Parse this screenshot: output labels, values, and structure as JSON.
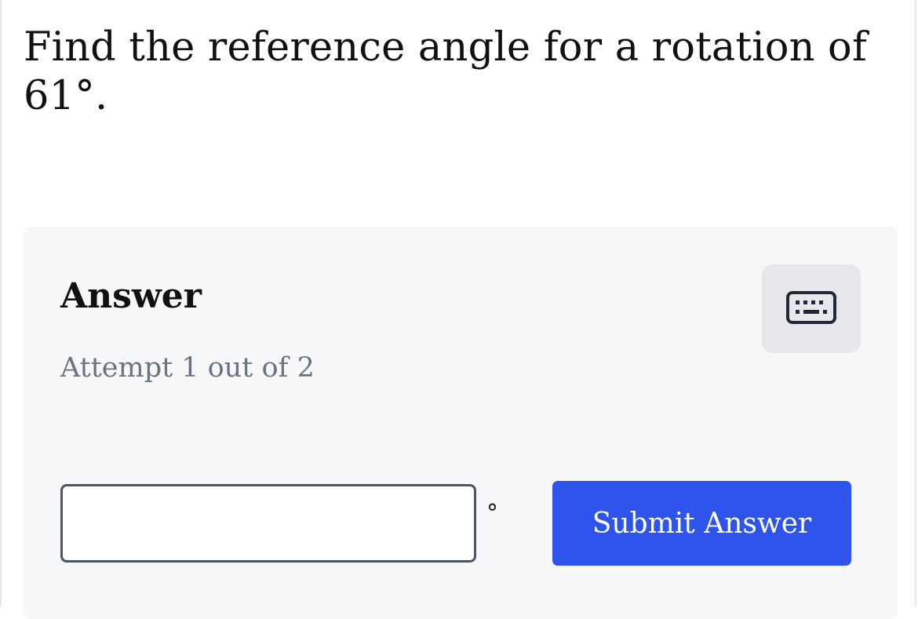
{
  "question": {
    "text": "Find the reference angle for a rotation of 61°."
  },
  "answer_panel": {
    "heading": "Answer",
    "attempt": "Attempt 1 out of 2",
    "keyboard_icon": "keyboard-icon",
    "input": {
      "value": "",
      "placeholder": ""
    },
    "unit": "°",
    "submit_label": "Submit Answer"
  },
  "colors": {
    "submit_button": "#2f54eb",
    "panel_background": "#f6f7f9",
    "keyboard_button": "#e5e7eb",
    "muted_text": "#6b7280"
  }
}
